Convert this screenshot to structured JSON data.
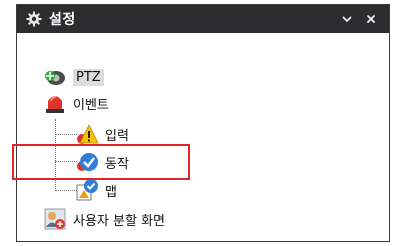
{
  "window": {
    "title": "설정"
  },
  "titlebar_buttons": {
    "dropdown_icon": "chevron-down-icon",
    "close_icon": "close-icon"
  },
  "tree": {
    "ptz": {
      "label": "PTZ",
      "icon": "ptz-camera-icon"
    },
    "event": {
      "label": "이벤트",
      "icon": "alarm-light-icon"
    },
    "event_children": {
      "input": {
        "label": "입력",
        "icon": "warning-icon"
      },
      "action": {
        "label": "동작",
        "icon": "check-icon"
      },
      "map": {
        "label": "맵",
        "icon": "map-check-icon"
      }
    },
    "split": {
      "label": "사용자 분할 화면",
      "icon": "user-split-screen-icon"
    }
  },
  "highlight_color": "#e3252b",
  "titlebar_color": "#2d2d30"
}
